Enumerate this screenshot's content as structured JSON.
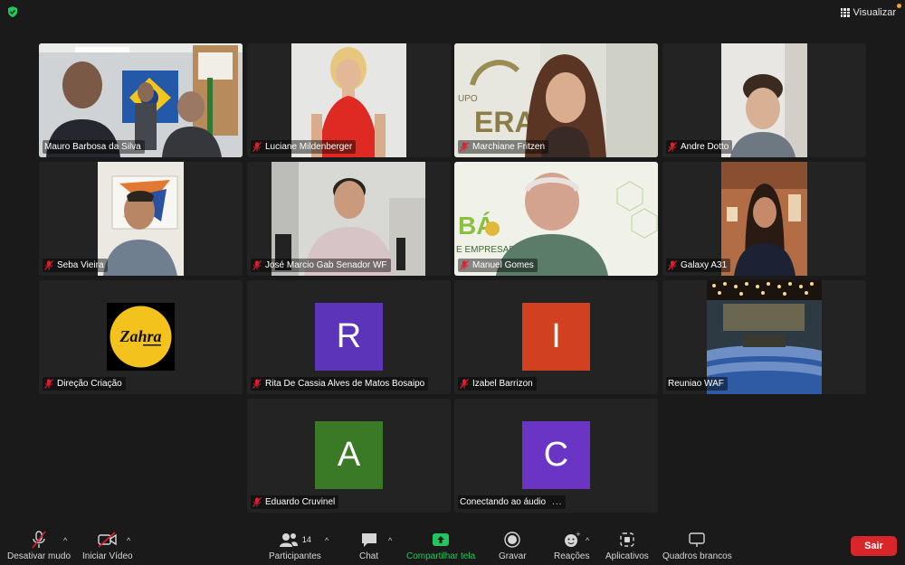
{
  "top_bar": {
    "view_label": "Visualizar"
  },
  "participants": [
    {
      "name": "Mauro Barbosa da Silva",
      "active_speaker": true
    },
    {
      "name": "Luciane Mildenberger",
      "muted": true
    },
    {
      "name": "Marchiane Fritzen",
      "muted": true
    },
    {
      "name": "Andre Dotto",
      "muted": true
    },
    {
      "name": "Seba Vieira",
      "muted": true
    },
    {
      "name": "José Marcio Gab Senador WF",
      "muted": true
    },
    {
      "name": "Manuel Gomes",
      "muted": true
    },
    {
      "name": "Galaxy A31",
      "muted": true
    },
    {
      "name": "Direção Criação",
      "muted": true,
      "logo_text": "Zahra"
    },
    {
      "name": "Rita De Cassia Alves de Matos Bosaipo",
      "muted": true,
      "initial": "R",
      "color": "#5b34b9"
    },
    {
      "name": "Izabel Barrizon",
      "muted": true,
      "initial": "I",
      "color": "#d1401f"
    },
    {
      "name": "Reuniao WAF",
      "muted": false
    },
    {
      "name": "Eduardo Cruvinel",
      "muted": true,
      "initial": "A",
      "color": "#3a7a27"
    },
    {
      "name": "Conectando ao áudio",
      "muted": false,
      "initial": "C",
      "color": "#6a34c4",
      "status_dots": "..."
    }
  ],
  "toolbar": {
    "mute_label": "Desativar mudo",
    "video_label": "Iniciar Vídeo",
    "participants_label": "Participantes",
    "participants_count": "14",
    "chat_label": "Chat",
    "share_label": "Compartilhar tela",
    "record_label": "Gravar",
    "reactions_label": "Reações",
    "apps_label": "Aplicativos",
    "whiteboards_label": "Quadros brancos",
    "leave_label": "Sair"
  },
  "colors": {
    "accent_green": "#22c55e",
    "leave_red": "#d9262b",
    "background": "#1a1a1a",
    "tile": "#232323"
  }
}
